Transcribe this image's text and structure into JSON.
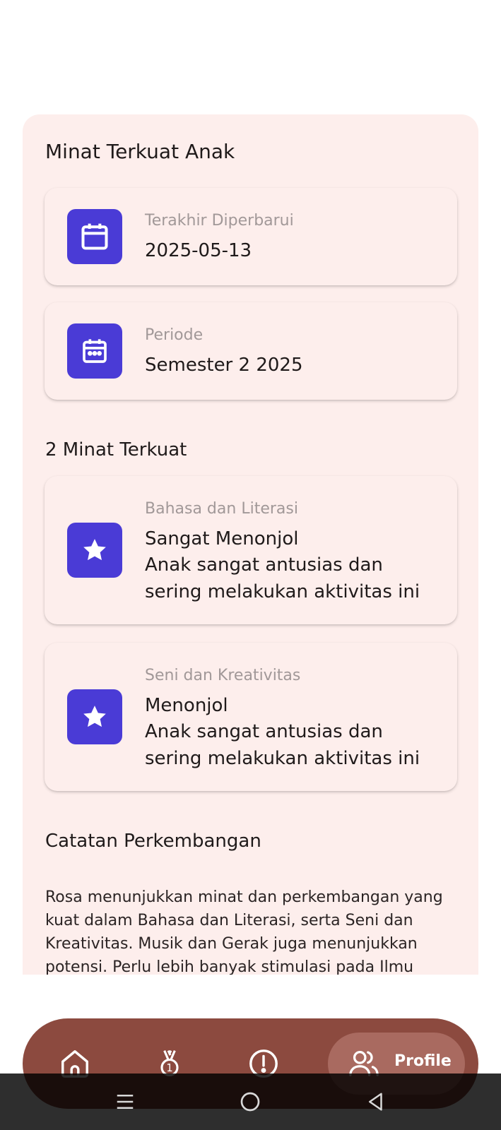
{
  "panel": {
    "title": "Minat Terkuat Anak"
  },
  "info_cards": [
    {
      "icon": "calendar-icon",
      "caption": "Terakhir Diperbarui",
      "value": "2025-05-13"
    },
    {
      "icon": "calendar-dots-icon",
      "caption": "Periode",
      "value": "Semester 2 2025"
    }
  ],
  "interests": {
    "title": "2 Minat Terkuat",
    "items": [
      {
        "icon": "star-icon",
        "category": "Bahasa dan Literasi",
        "level": "Sangat Menonjol",
        "description": "Anak sangat antusias dan sering melakukan aktivitas ini"
      },
      {
        "icon": "star-icon",
        "category": "Seni dan Kreativitas",
        "level": "Menonjol",
        "description": "Anak sangat antusias dan sering melakukan aktivitas ini"
      }
    ]
  },
  "notes": {
    "title": "Catatan Perkembangan",
    "text": "Rosa menunjukkan minat dan perkembangan yang kuat dalam Bahasa dan Literasi, serta Seni dan Kreativitas. Musik dan Gerak juga menunjukkan potensi. Perlu lebih banyak stimulasi pada Ilmu"
  },
  "bottom_nav": {
    "items": [
      {
        "icon": "home-icon"
      },
      {
        "icon": "medal-icon"
      },
      {
        "icon": "alert-icon"
      },
      {
        "icon": "users-icon",
        "label": "Profile",
        "active": true
      }
    ]
  },
  "colors": {
    "accent": "#4a3bd6",
    "panel": "#fdeeec",
    "nav": "#8c4a3f",
    "nav_active": "#a96a60"
  }
}
